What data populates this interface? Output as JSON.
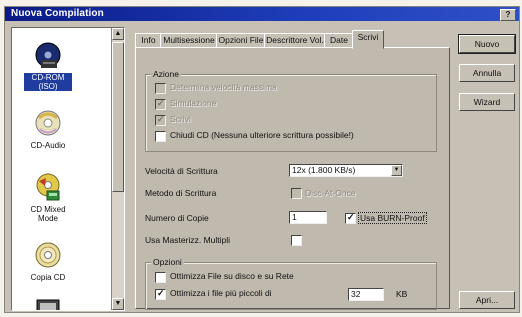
{
  "window": {
    "title": "Nuova Compilation",
    "help_label": "?"
  },
  "left_panel": {
    "items": [
      {
        "label": "CD-ROM (ISO)",
        "icon": "cd-rom-disc-icon",
        "selected": true
      },
      {
        "label": "CD-Audio",
        "icon": "cd-audio-icon",
        "selected": false
      },
      {
        "label": "CD Mixed Mode",
        "icon": "cd-mixed-mode-icon",
        "selected": false
      },
      {
        "label": "Copia CD",
        "icon": "copy-cd-icon",
        "selected": false
      }
    ]
  },
  "tabs": [
    {
      "label": "Info",
      "active": false
    },
    {
      "label": "Multisessione",
      "active": false
    },
    {
      "label": "Opzioni File",
      "active": false
    },
    {
      "label": "Descrittore Vol.",
      "active": false
    },
    {
      "label": "Date",
      "active": false
    },
    {
      "label": "Scrivi",
      "active": true
    }
  ],
  "azione": {
    "title": "Azione",
    "items": [
      {
        "label": "Determina velocità massima",
        "checked": false,
        "disabled": true
      },
      {
        "label": "Simulazione",
        "checked": true,
        "disabled": true
      },
      {
        "label": "Scrivi",
        "checked": true,
        "disabled": true
      },
      {
        "label": "Chiudi CD (Nessuna ulteriore scrittura possibile!)",
        "checked": false,
        "disabled": false
      }
    ]
  },
  "settings": {
    "speed_label": "Velocità di Scrittura",
    "speed_value": "12x (1.800 KB/s)",
    "method_label": "Metodo di Scrittura",
    "method_checkbox_label": "Disc-At-Once",
    "copies_label": "Numero di Copie",
    "copies_value": "1",
    "burnproof_label": "Usa BURN-Proof",
    "burnproof_checked": true,
    "multi_label": "Usa Masterizz. Multipli",
    "multi_checked": false
  },
  "opzioni": {
    "title": "Opzioni",
    "optimize_label": "Ottimizza File su disco e su Rete",
    "optimize_checked": false,
    "small_label": "Ottimizza i file più piccoli di",
    "small_checked": true,
    "small_value": "32",
    "small_unit": "KB"
  },
  "buttons": {
    "new": "Nuovo",
    "cancel": "Annulla",
    "wizard": "Wizard",
    "open": "Apri..."
  }
}
